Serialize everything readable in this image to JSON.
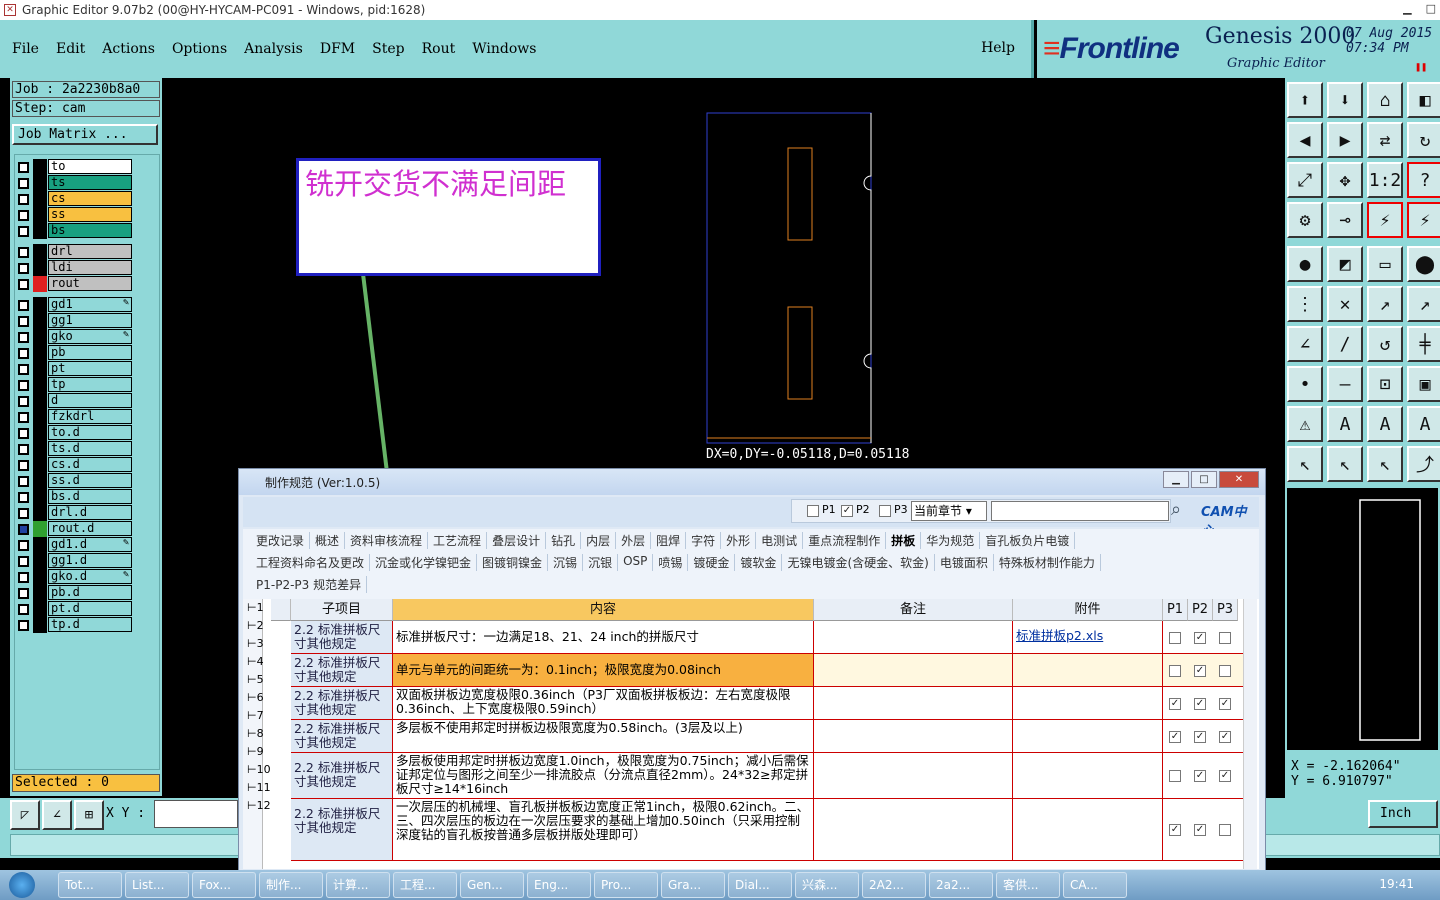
{
  "window": {
    "title": "Graphic Editor 9.07b2 (00@HY-HYCAM-PC091 - Windows, pid:1628)"
  },
  "menu": [
    "File",
    "Edit",
    "Actions",
    "Options",
    "Analysis",
    "DFM",
    "Step",
    "Rout",
    "Windows"
  ],
  "help": "Help",
  "brand": {
    "logo": "Frontline",
    "product": "Genesis 2000",
    "subtitle": "Graphic Editor",
    "date": "07 Aug 2015",
    "time": "07:34 PM"
  },
  "job": "Job : 2a2230b8a0",
  "step": "Step: cam",
  "job_matrix": "Job Matrix ...",
  "layers": [
    {
      "name": "to",
      "color": "#ffffff"
    },
    {
      "name": "ts",
      "color": "#18a080"
    },
    {
      "name": "cs",
      "color": "#f8c040"
    },
    {
      "name": "ss",
      "color": "#f8c040"
    },
    {
      "name": "bs",
      "color": "#18a080"
    },
    {
      "name": "drl",
      "color": "#c0c0c0"
    },
    {
      "name": "ldi",
      "color": "#c0c0c0"
    },
    {
      "name": "rout",
      "color": "#c0c0c0"
    },
    {
      "name": "gd1",
      "color": "#90d8d8"
    },
    {
      "name": "gg1",
      "color": "#90d8d8"
    },
    {
      "name": "gko",
      "color": "#90d8d8"
    },
    {
      "name": "pb",
      "color": "#90d8d8"
    },
    {
      "name": "pt",
      "color": "#90d8d8"
    },
    {
      "name": "tp",
      "color": "#90d8d8"
    },
    {
      "name": "d",
      "color": "#90d8d8"
    },
    {
      "name": "fzkdrl",
      "color": "#90d8d8"
    },
    {
      "name": "to.d",
      "color": "#90d8d8"
    },
    {
      "name": "ts.d",
      "color": "#90d8d8"
    },
    {
      "name": "cs.d",
      "color": "#90d8d8"
    },
    {
      "name": "ss.d",
      "color": "#90d8d8"
    },
    {
      "name": "bs.d",
      "color": "#90d8d8"
    },
    {
      "name": "drl.d",
      "color": "#90d8d8"
    },
    {
      "name": "rout.d",
      "color": "#90d8d8"
    },
    {
      "name": "gd1.d",
      "color": "#90d8d8"
    },
    {
      "name": "gg1.d",
      "color": "#90d8d8"
    },
    {
      "name": "gko.d",
      "color": "#90d8d8"
    },
    {
      "name": "pb.d",
      "color": "#90d8d8"
    },
    {
      "name": "pt.d",
      "color": "#90d8d8"
    },
    {
      "name": "tp.d",
      "color": "#90d8d8"
    }
  ],
  "selected": "Selected : 0",
  "xy_label": "X Y :",
  "note": "铣开交货不满足间距",
  "measure": "DX=0,DY=-0.05118,D=0.05118",
  "cursor": {
    "x": "X = -2.162064\"",
    "y": "Y = 6.910797\""
  },
  "units": "Inch",
  "dialog": {
    "title": "制作规范 (Ver:1.0.5)",
    "filters": [
      "P1",
      "P2",
      "P3"
    ],
    "chapter": "当前章节",
    "cam_logo": "CAM中心",
    "tabs_row1": [
      "更改记录",
      "概述",
      "资料审核流程",
      "工艺流程",
      "叠层设计",
      "钻孔",
      "内层",
      "外层",
      "阻焊",
      "字符",
      "外形",
      "电测试",
      "重点流程制作",
      "拼板",
      "华为规范",
      "盲孔板负片电镀"
    ],
    "tabs_row2": [
      "工程资料命名及更改",
      "沉金或化学镍钯金",
      "图镀铜镍金",
      "沉锡",
      "沉银",
      "OSP",
      "喷锡",
      "镀硬金",
      "镀软金",
      "无镍电镀金(含硬金、软金)",
      "电镀面积",
      "特殊板材制作能力"
    ],
    "tabs_row3": [
      "P1-P2-P3 规范差异"
    ],
    "active_tab": "拼板",
    "headers": [
      "子项目",
      "内容",
      "备注",
      "附件",
      "P1",
      "P2",
      "P3"
    ],
    "rownums": [
      "1",
      "2",
      "3",
      "4",
      "5",
      "6",
      "7",
      "8",
      "9",
      "10",
      "11",
      "12"
    ],
    "rows": [
      {
        "sub": "2.2 标准拼板尺寸其他规定",
        "content": "标准拼板尺寸：一边满足18、21、24 inch的拼版尺寸",
        "note": "",
        "attach": "标准拼板p2.xls",
        "p1": false,
        "p2": true,
        "p3": false
      },
      {
        "sub": "2.2 标准拼板尺寸其他规定",
        "content": "单元与单元的间距统一为：0.1inch；极限宽度为0.08inch",
        "note": "",
        "attach": "",
        "p1": false,
        "p2": true,
        "p3": false
      },
      {
        "sub": "2.2 标准拼板尺寸其他规定",
        "content": "双面板拼板边宽度极限0.36inch（P3厂双面板拼板板边：左右宽度极限0.36inch、上下宽度极限0.59inch）",
        "note": "",
        "attach": "",
        "p1": true,
        "p2": true,
        "p3": true
      },
      {
        "sub": "2.2 标准拼板尺寸其他规定",
        "content": "多层板不使用邦定时拼板边极限宽度为0.58inch。(3层及以上)",
        "note": "",
        "attach": "",
        "p1": true,
        "p2": true,
        "p3": true
      },
      {
        "sub": "2.2 标准拼板尺寸其他规定",
        "content": "多层板使用邦定时拼板边宽度1.0inch，极限宽度为0.75inch；减小后需保证邦定位与图形之间至少一排流胶点（分流点直径2mm）。24*32≥邦定拼板尺寸≥14*16inch",
        "note": "",
        "attach": "",
        "p1": false,
        "p2": true,
        "p3": true
      },
      {
        "sub": "2.2 标准拼板尺寸其他规定",
        "content": "一次层压的机械埋、盲孔板拼板板边宽度正常1inch，极限0.62inch。二、三、四次层压的板边在一次层压要求的基础上增加0.50inch（只采用控制深度钻的盲孔板按普通多层板拼版处理即可）",
        "note": "",
        "attach": "",
        "p1": true,
        "p2": true,
        "p3": false
      }
    ]
  },
  "taskbar": {
    "tasks": [
      "Tot...",
      "List...",
      "Fox...",
      "制作...",
      "计算...",
      "工程...",
      "Gen...",
      "Eng...",
      "Pro...",
      "Gra...",
      "Dial...",
      "兴森...",
      "2A2...",
      "2a2...",
      "客供...",
      "CA..."
    ],
    "clock": "19:41"
  }
}
